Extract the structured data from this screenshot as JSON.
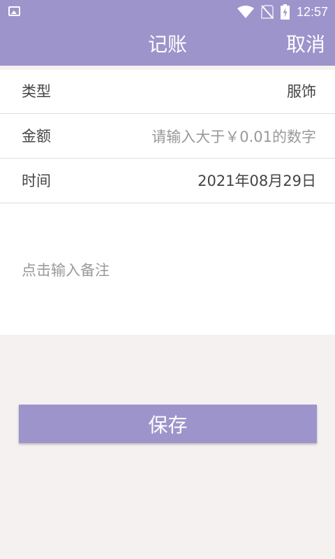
{
  "status_bar": {
    "time": "12:57",
    "icons": [
      "image-icon",
      "wifi-icon",
      "no-sim-icon",
      "battery-charging-icon"
    ]
  },
  "app_bar": {
    "title": "记账",
    "cancel_label": "取消"
  },
  "form": {
    "type": {
      "label": "类型",
      "value": "服饰"
    },
    "amount": {
      "label": "金额",
      "value": "",
      "placeholder": "请输入大于￥0.01的数字"
    },
    "time": {
      "label": "时间",
      "value": "2021年08月29日"
    },
    "note": {
      "value": "",
      "placeholder": "点击输入备注"
    }
  },
  "save_label": "保存",
  "colors": {
    "accent": "#9d94cb",
    "background": "#f5f1f1",
    "surface": "#ffffff",
    "text": "#444444",
    "hint": "#999999"
  }
}
